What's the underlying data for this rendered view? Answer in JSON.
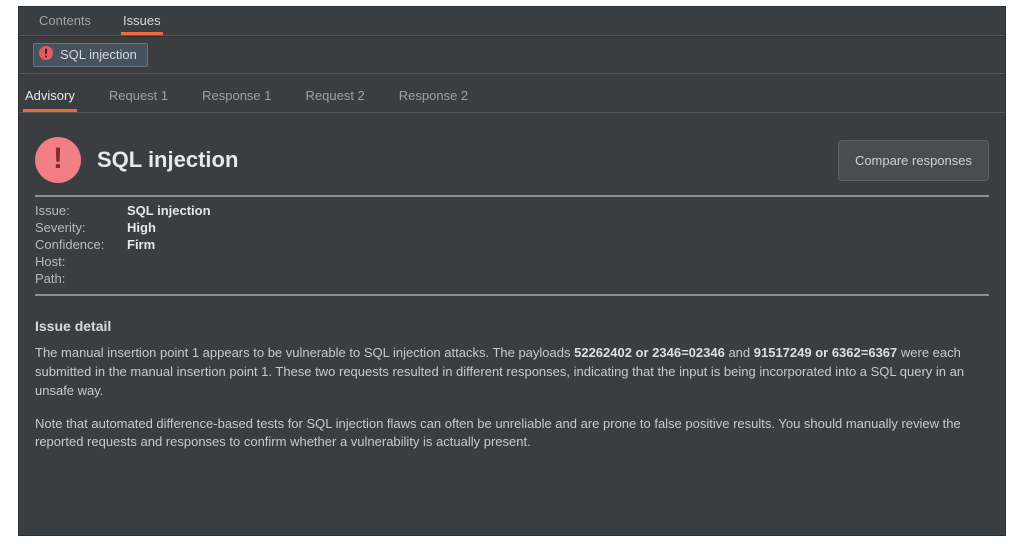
{
  "top_tabs": [
    {
      "label": "Contents",
      "active": false
    },
    {
      "label": "Issues",
      "active": true
    }
  ],
  "chip": {
    "label": "SQL injection"
  },
  "sub_tabs": [
    {
      "label": "Advisory",
      "active": true
    },
    {
      "label": "Request 1",
      "active": false
    },
    {
      "label": "Response 1",
      "active": false
    },
    {
      "label": "Request 2",
      "active": false
    },
    {
      "label": "Response 2",
      "active": false
    }
  ],
  "title": "SQL injection",
  "compare_button": "Compare responses",
  "meta": {
    "issue_k": "Issue:",
    "severity_k": "Severity:",
    "confidence_k": "Confidence:",
    "host_k": "Host:",
    "path_k": "Path:",
    "issue_v": "SQL injection",
    "severity_v": "High",
    "confidence_v": "Firm",
    "host_v": "",
    "path_v": ""
  },
  "detail_heading": "Issue detail",
  "detail": {
    "p1_a": "The manual insertion point 1 appears to be vulnerable to SQL injection attacks. The payloads ",
    "p1_b1": "52262402 or 2346=02346",
    "p1_c": " and ",
    "p1_b2": "91517249 or 6362=6367",
    "p1_d": " were each submitted in the manual insertion point 1. These two requests resulted in different responses, indicating that the input is being incorporated into a SQL query in an unsafe way.",
    "p2": "Note that automated difference-based tests for SQL injection flaws can often be unreliable and are prone to false positive results. You should manually review the reported requests and responses to confirm whether a vulnerability is actually present."
  }
}
